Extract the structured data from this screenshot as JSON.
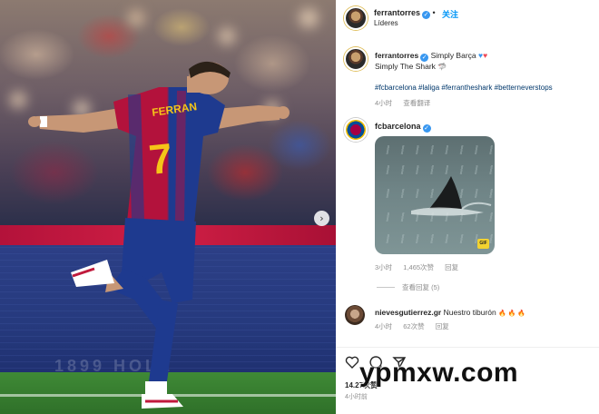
{
  "post": {
    "author": "ferrantorres",
    "follow_label": "关注",
    "location": "Líderes",
    "caption_user": "ferrantorres",
    "caption_line1": "Simply Barça",
    "caption_line2": "Simply The Shark",
    "shark_emoji": "🦈",
    "hashtags": "#fcbarcelona #laliga #ferrantheshark #betterneverstops",
    "caption_time": "4小时",
    "translate_label": "查看翻译"
  },
  "comments": [
    {
      "user": "fcbarcelona",
      "time": "3小时",
      "likes": "1,465次赞",
      "reply_label": "回复",
      "view_replies": "查看回复 (5)",
      "image_badge": "GIF"
    },
    {
      "user": "nievesgutierrez.gr",
      "text": "Nuestro tiburón",
      "emoji": "🔥 🔥 🔥",
      "time": "4小时",
      "likes": "62次赞",
      "reply_label": "回复"
    }
  ],
  "footer": {
    "likes_count": "14.27",
    "likes_suffix": "次赞",
    "time": "4小时前"
  },
  "photo": {
    "jersey_name": "FERRAN",
    "jersey_number": "7",
    "ad_text": "1899 HOLE"
  },
  "watermark": "ypmxw.com",
  "icons": {
    "verified": "verified-badge-icon",
    "carousel_next": "chevron-right-icon",
    "like": "heart-icon",
    "comment": "comment-icon",
    "share": "send-icon"
  },
  "colors": {
    "link_blue": "#0095f6",
    "barca_red": "#a50044",
    "barca_blue": "#004d98",
    "verified_blue": "#3897f0"
  }
}
